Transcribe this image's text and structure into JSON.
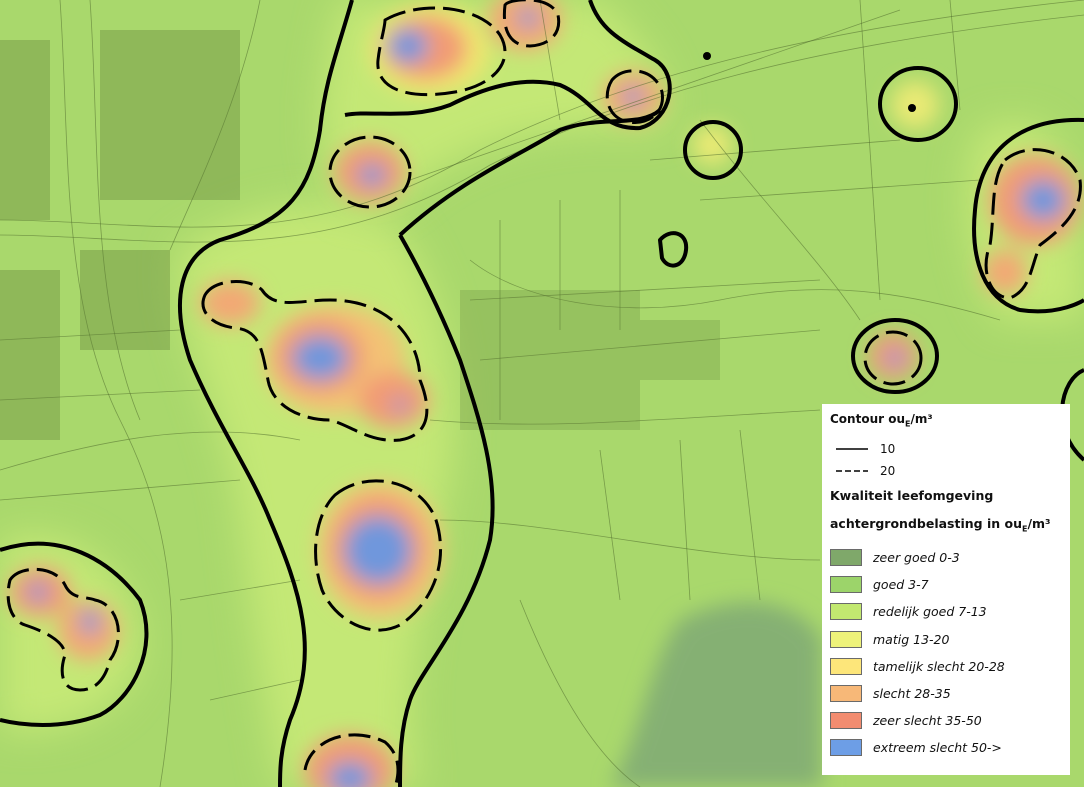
{
  "legend": {
    "contour_title": "Contour ou",
    "contour_title_sub": "E",
    "contour_title_unit": "/m³",
    "contours": [
      {
        "value": "10",
        "style": "solid"
      },
      {
        "value": "20",
        "style": "dashed"
      }
    ],
    "quality_title_line1": "Kwaliteit leefomgeving",
    "quality_title_line2": "achtergrondbelasting in ou",
    "quality_title_sub": "E",
    "quality_title_unit": "/m³",
    "classes": [
      {
        "label": "zeer goed 0-3",
        "color": "#7fa86a"
      },
      {
        "label": "goed 3-7",
        "color": "#9cd46a"
      },
      {
        "label": "redelijk goed 7-13",
        "color": "#c2e870"
      },
      {
        "label": "matig 13-20",
        "color": "#eef27a"
      },
      {
        "label": "tamelijk slecht 20-28",
        "color": "#fde67a"
      },
      {
        "label": "slecht 28-35",
        "color": "#f7b878"
      },
      {
        "label": "zeer slecht 35-50",
        "color": "#f28c70"
      },
      {
        "label": "extreem slecht 50->",
        "color": "#6d9ee6"
      }
    ]
  }
}
